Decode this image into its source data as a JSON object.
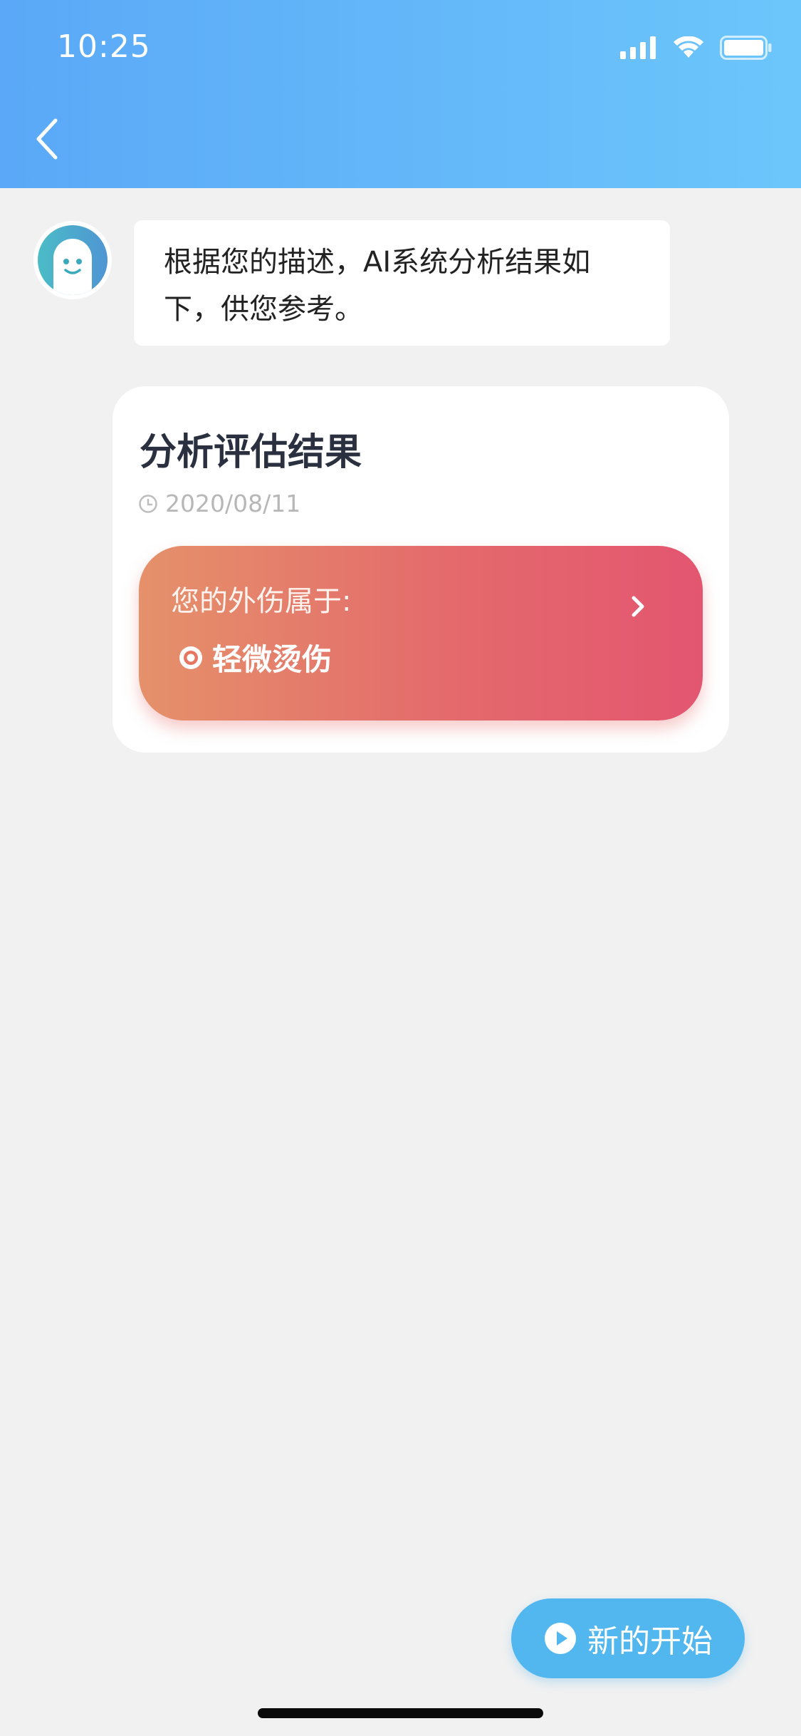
{
  "status_bar": {
    "time": "10:25"
  },
  "icons": {
    "back": "chevron-left-icon",
    "clock": "clock-icon",
    "target": "target-icon",
    "play": "play-icon"
  },
  "chat": {
    "message": "根据您的描述，AI系统分析结果如下，供您参考。"
  },
  "result_card": {
    "title": "分析评估结果",
    "date": "2020/08/11",
    "label": "您的外伤属于:",
    "value": "轻微烫伤"
  },
  "actions": {
    "new_start_label": "新的开始"
  },
  "colors": {
    "header_start": "#5aa8f7",
    "header_end": "#6cc6fb",
    "result_start": "#e5916a",
    "result_end": "#e35670",
    "primary_button": "#53b7ef"
  }
}
